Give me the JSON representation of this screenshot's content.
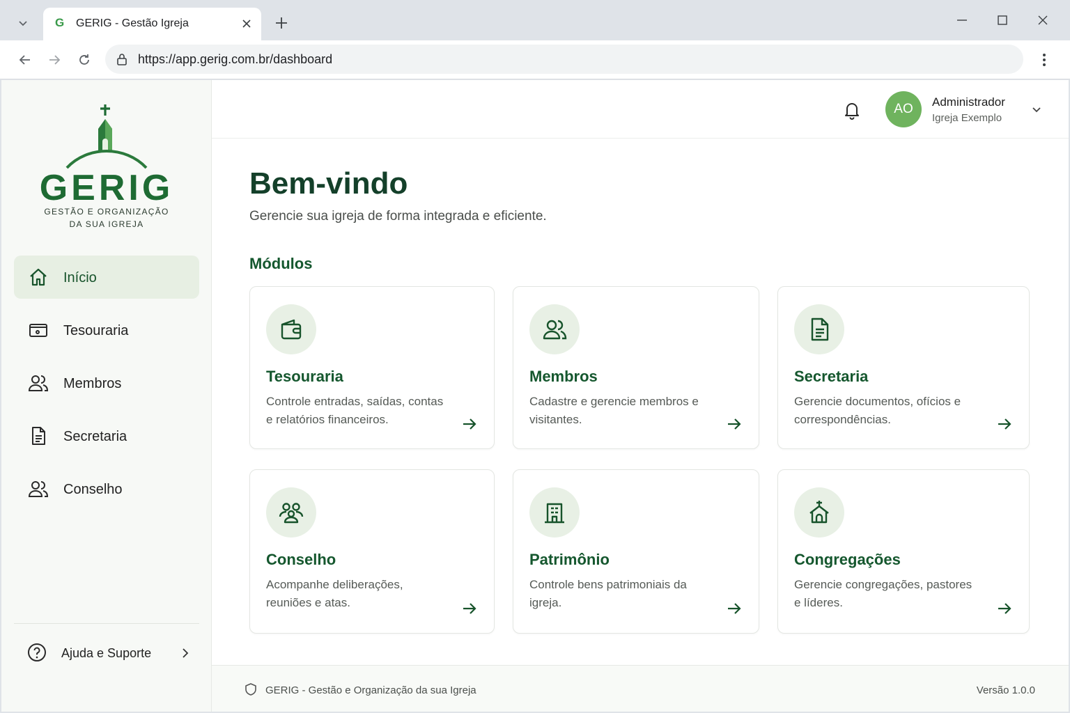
{
  "browser": {
    "tab_title": "GERIG - Gestão Igreja",
    "tab_favicon": "G",
    "url": "https://app.gerig.com.br/dashboard"
  },
  "logo": {
    "word": "GERIG",
    "sub_line1": "GESTÃO E ORGANIZAÇÃO",
    "sub_line2": "DA SUA IGREJA"
  },
  "sidebar": {
    "items": [
      {
        "label": "Início",
        "icon": "home-icon",
        "active": true
      },
      {
        "label": "Tesouraria",
        "icon": "wallet-icon"
      },
      {
        "label": "Membros",
        "icon": "users-icon"
      },
      {
        "label": "Secretaria",
        "icon": "document-icon"
      },
      {
        "label": "Conselho",
        "icon": "users-icon"
      }
    ],
    "help_label": "Ajuda e Suporte"
  },
  "user": {
    "initials": "AO",
    "name": "Administrador",
    "org": "Igreja Exemplo"
  },
  "main": {
    "title": "Bem-vindo",
    "subtitle": "Gerencie sua igreja de forma integrada e eficiente.",
    "section_title": "Módulos",
    "cards": [
      {
        "title": "Tesouraria",
        "desc": "Controle entradas, saídas, contas e relatórios financeiros.",
        "icon": "wallet-icon"
      },
      {
        "title": "Membros",
        "desc": "Cadastre e gerencie membros e visitantes.",
        "icon": "users-icon"
      },
      {
        "title": "Secretaria",
        "desc": "Gerencie documentos, ofícios e correspondências.",
        "icon": "document-icon"
      },
      {
        "title": "Conselho",
        "desc": "Acompanhe deliberações, reuniões e atas.",
        "icon": "group-icon"
      },
      {
        "title": "Patrimônio",
        "desc": "Controle bens patrimoniais da igreja.",
        "icon": "building-icon"
      },
      {
        "title": "Congregações",
        "desc": "Gerencie congregações, pastores e líderes.",
        "icon": "church-icon"
      }
    ]
  },
  "footer": {
    "text": "GERIG - Gestão e Organização da sua Igreja",
    "version": "Versão 1.0.0"
  },
  "colors": {
    "brand": "#1e6b33",
    "accent": "#6fb35e",
    "active_bg": "#e7efe3"
  }
}
